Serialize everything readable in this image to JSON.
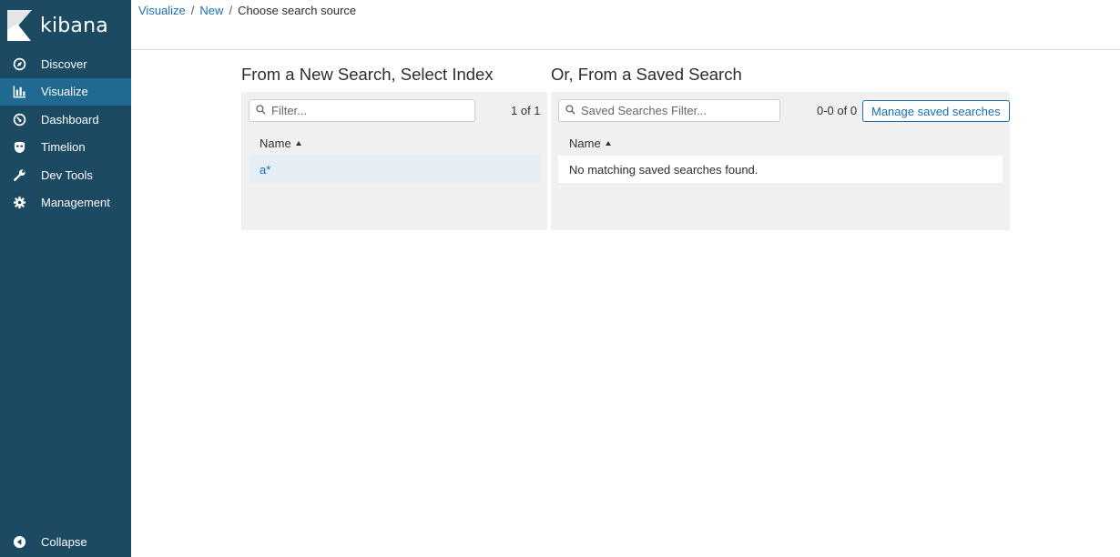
{
  "sidebar": {
    "brand": "kibana",
    "items": [
      {
        "label": "Discover",
        "icon": "compass-icon"
      },
      {
        "label": "Visualize",
        "icon": "bar-chart-icon",
        "active": true
      },
      {
        "label": "Dashboard",
        "icon": "dashboard-gauge-icon"
      },
      {
        "label": "Timelion",
        "icon": "timelion-mask-icon"
      },
      {
        "label": "Dev Tools",
        "icon": "wrench-icon"
      },
      {
        "label": "Management",
        "icon": "gear-icon"
      }
    ],
    "collapse_label": "Collapse"
  },
  "breadcrumb": {
    "items": [
      "Visualize",
      "New"
    ],
    "separator": "/",
    "current": "Choose search source"
  },
  "new_search": {
    "title": "From a New Search, Select Index",
    "filter_placeholder": "Filter...",
    "count": "1 of 1",
    "column": "Name",
    "rows": [
      "a*"
    ]
  },
  "saved_search": {
    "title": "Or, From a Saved Search",
    "filter_placeholder": "Saved Searches Filter...",
    "count": "0-0 of 0",
    "manage_label": "Manage saved searches",
    "column": "Name",
    "empty_message": "No matching saved searches found."
  },
  "colors": {
    "sidebar_bg": "#1c4a63",
    "sidebar_active": "#206a92",
    "link": "#1a6eb1",
    "panel_bg": "#f0f0f0",
    "row_highlight": "#e4eef4"
  }
}
